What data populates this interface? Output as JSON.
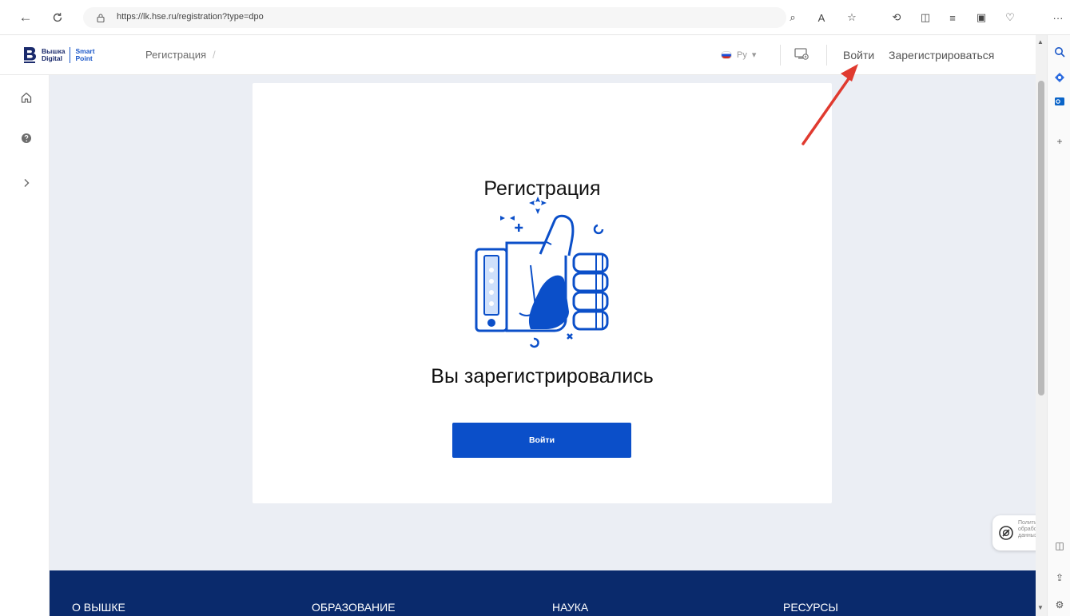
{
  "browser": {
    "url": "https://lk.hse.ru/registration?type=dpo",
    "more": "···"
  },
  "header": {
    "logo_line1": "Вышка",
    "logo_line2": "Digital",
    "logo_smart": "Smart",
    "logo_point": "Point",
    "breadcrumb": "Регистрация",
    "breadcrumb_sep": "/",
    "language": "Ру",
    "language_caret": "▾",
    "login_label": "Войти",
    "register_label": "Зарегистрироваться"
  },
  "card": {
    "title": "Регистрация",
    "success_message": "Вы зарегистрировались",
    "login_button": "Войти"
  },
  "privacy": {
    "label_line1": "Политика",
    "label_line2": "обработки",
    "label_line3": "данных",
    "close": "×"
  },
  "footer": {
    "items": [
      "О ВЫШКЕ",
      "ОБРАЗОВАНИЕ",
      "НАУКА",
      "РЕСУРСЫ"
    ]
  },
  "colors": {
    "primary": "#0b4fc9",
    "footer_bg": "#0a2a6c",
    "page_bg": "#ebeef4",
    "annotation_arrow": "#e03a2f"
  }
}
